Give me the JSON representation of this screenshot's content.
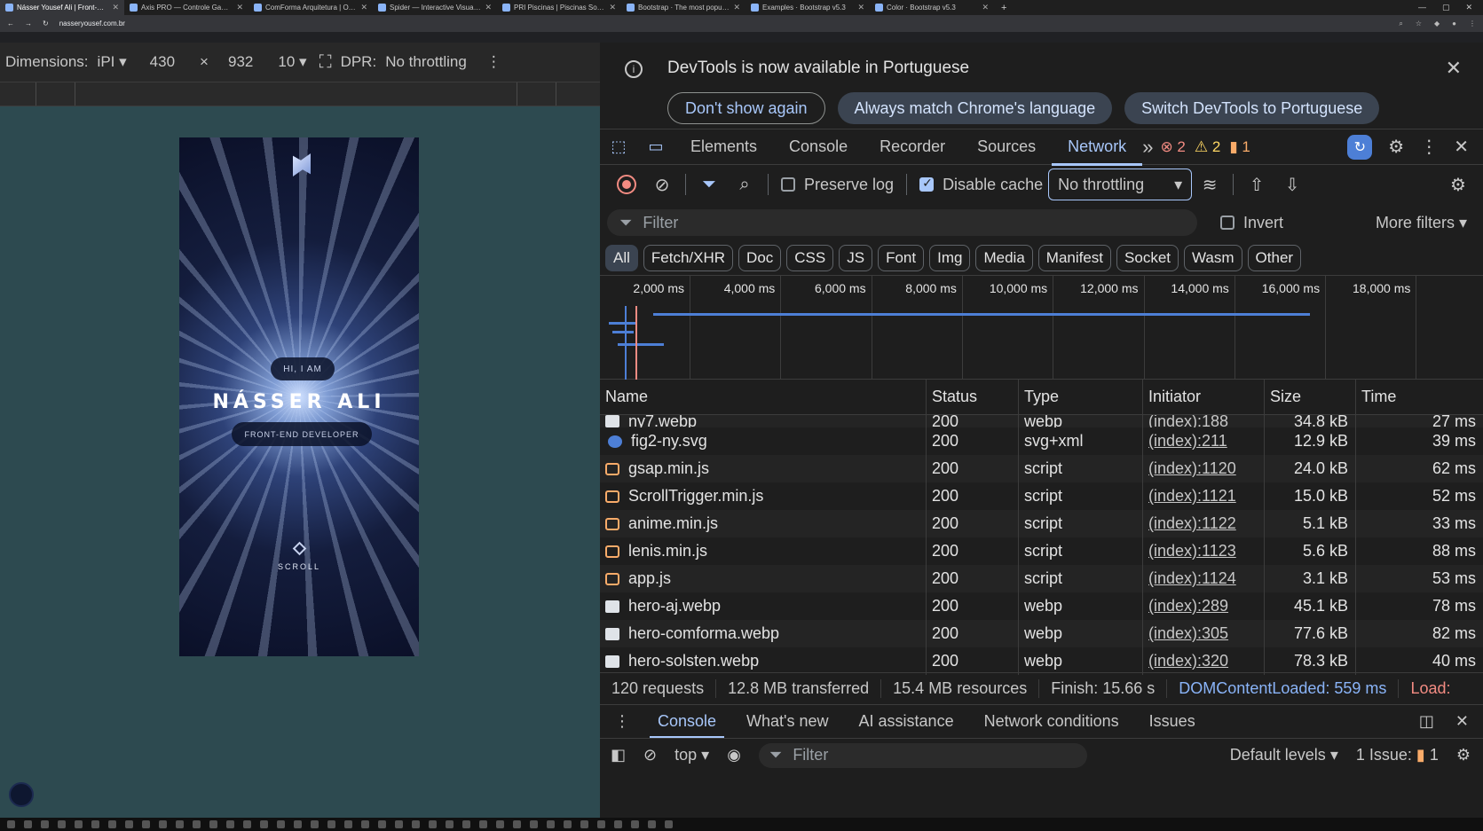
{
  "browser": {
    "tabs": [
      {
        "title": "Násser Yousef Ali | Front-End &",
        "active": true
      },
      {
        "title": "Axis PRO — Controle Gamer Pi",
        "active": false
      },
      {
        "title": "ComForma Arquitetura | Onde",
        "active": false
      },
      {
        "title": "Spider — Interactive Visual Exp",
        "active": false
      },
      {
        "title": "PRI Piscinas | Piscinas Sob Med",
        "active": false
      },
      {
        "title": "Bootstrap · The most popular H",
        "active": false
      },
      {
        "title": "Examples · Bootstrap v5.3",
        "active": false
      },
      {
        "title": "Color · Bootstrap v5.3",
        "active": false
      }
    ],
    "url": "nasseryousef.com.br"
  },
  "device_toolbar": {
    "dimensions_label": "Dimensions:",
    "device": "iPI",
    "width": "430",
    "times": "×",
    "height": "932",
    "zoom": "10",
    "dpr_label": "DPR:",
    "throttle": "No throttling"
  },
  "site": {
    "greeting": "HI, I AM",
    "name": "NÁSSER ALI",
    "role": "FRONT-END DEVELOPER",
    "scroll": "SCROLL"
  },
  "devtools": {
    "infobar": {
      "message": "DevTools is now available in Portuguese",
      "btn_dont_show": "Don't show again",
      "btn_match": "Always match Chrome's language",
      "btn_switch": "Switch DevTools to Portuguese"
    },
    "tabs": {
      "elements": "Elements",
      "console": "Console",
      "recorder": "Recorder",
      "sources": "Sources",
      "network": "Network",
      "more": "»",
      "errors": "2",
      "warnings": "2",
      "issues": "1"
    },
    "toolbar": {
      "preserve_log": "Preserve log",
      "disable_cache": "Disable cache",
      "throttling": "No throttling"
    },
    "filter": {
      "placeholder": "Filter",
      "invert": "Invert",
      "more_filters": "More filters"
    },
    "type_filters": [
      "All",
      "Fetch/XHR",
      "Doc",
      "CSS",
      "JS",
      "Font",
      "Img",
      "Media",
      "Manifest",
      "Socket",
      "Wasm",
      "Other"
    ],
    "timeline_ticks": [
      "2,000 ms",
      "4,000 ms",
      "6,000 ms",
      "8,000 ms",
      "10,000 ms",
      "12,000 ms",
      "14,000 ms",
      "16,000 ms",
      "18,000 ms"
    ],
    "columns": {
      "name": "Name",
      "status": "Status",
      "type": "Type",
      "initiator": "Initiator",
      "size": "Size",
      "time": "Time"
    },
    "rows": [
      {
        "name": "ny7.webp",
        "status": "200",
        "type": "webp",
        "initiator": "(index):188",
        "size": "34.8 kB",
        "time": "27 ms",
        "kind": "img",
        "partial": true
      },
      {
        "name": "fig2-ny.svg",
        "status": "200",
        "type": "svg+xml",
        "initiator": "(index):211",
        "size": "12.9 kB",
        "time": "39 ms",
        "kind": "svg"
      },
      {
        "name": "gsap.min.js",
        "status": "200",
        "type": "script",
        "initiator": "(index):1120",
        "size": "24.0 kB",
        "time": "62 ms",
        "kind": "script"
      },
      {
        "name": "ScrollTrigger.min.js",
        "status": "200",
        "type": "script",
        "initiator": "(index):1121",
        "size": "15.0 kB",
        "time": "52 ms",
        "kind": "script"
      },
      {
        "name": "anime.min.js",
        "status": "200",
        "type": "script",
        "initiator": "(index):1122",
        "size": "5.1 kB",
        "time": "33 ms",
        "kind": "script"
      },
      {
        "name": "lenis.min.js",
        "status": "200",
        "type": "script",
        "initiator": "(index):1123",
        "size": "5.6 kB",
        "time": "88 ms",
        "kind": "script"
      },
      {
        "name": "app.js",
        "status": "200",
        "type": "script",
        "initiator": "(index):1124",
        "size": "3.1 kB",
        "time": "53 ms",
        "kind": "script"
      },
      {
        "name": "hero-aj.webp",
        "status": "200",
        "type": "webp",
        "initiator": "(index):289",
        "size": "45.1 kB",
        "time": "78 ms",
        "kind": "img"
      },
      {
        "name": "hero-comforma.webp",
        "status": "200",
        "type": "webp",
        "initiator": "(index):305",
        "size": "77.6 kB",
        "time": "82 ms",
        "kind": "img"
      },
      {
        "name": "hero-solsten.webp",
        "status": "200",
        "type": "webp",
        "initiator": "(index):320",
        "size": "78.3 kB",
        "time": "40 ms",
        "kind": "img"
      }
    ],
    "summary": {
      "requests": "120 requests",
      "transferred": "12.8 MB transferred",
      "resources": "15.4 MB resources",
      "finish": "Finish: 15.66 s",
      "dcl": "DOMContentLoaded: 559 ms",
      "load": "Load:"
    },
    "drawer": {
      "tabs": [
        "Console",
        "What's new",
        "AI assistance",
        "Network conditions",
        "Issues"
      ],
      "context": "top",
      "filter": "Filter",
      "levels": "Default levels",
      "issues_label": "1 Issue:",
      "issues_count": "1"
    }
  }
}
